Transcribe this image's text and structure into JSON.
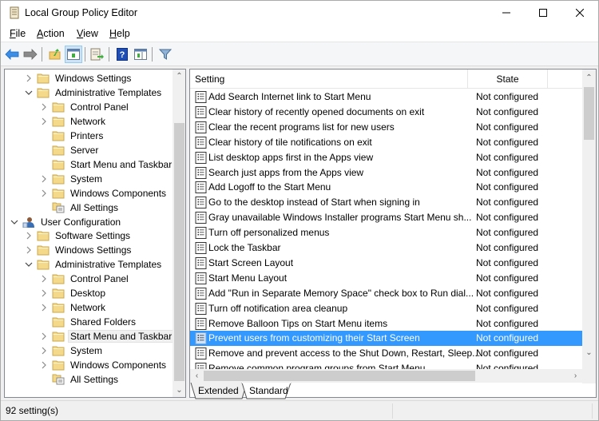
{
  "window": {
    "title": "Local Group Policy Editor",
    "app_icon": "scroll-policy-icon",
    "controls": {
      "minimize": "minimize-icon",
      "maximize": "maximize-icon",
      "close": "close-icon"
    }
  },
  "menubar": {
    "items": [
      {
        "label": "File",
        "accel": "F",
        "rest": "ile"
      },
      {
        "label": "Action",
        "accel": "A",
        "rest": "ction"
      },
      {
        "label": "View",
        "accel": "V",
        "rest": "iew"
      },
      {
        "label": "Help",
        "accel": "H",
        "rest": "elp"
      }
    ]
  },
  "toolbar": {
    "buttons": [
      {
        "name": "back",
        "icon": "arrow-left-icon"
      },
      {
        "name": "forward",
        "icon": "arrow-right-icon"
      },
      {
        "name": "up-one-level",
        "icon": "folder-up-icon"
      },
      {
        "name": "show-hide-console-tree",
        "icon": "console-tree-icon",
        "active": true
      },
      {
        "name": "export-list",
        "icon": "export-list-icon"
      },
      {
        "name": "help",
        "icon": "help-icon"
      },
      {
        "name": "show-hide-action-pane",
        "icon": "action-pane-icon"
      },
      {
        "name": "filter",
        "icon": "filter-icon"
      }
    ]
  },
  "tree": {
    "items": [
      {
        "label": "Windows Settings",
        "level": 2,
        "expander": "collapsed",
        "icon": "folder"
      },
      {
        "label": "Administrative Templates",
        "level": 2,
        "expander": "expanded",
        "icon": "folder"
      },
      {
        "label": "Control Panel",
        "level": 3,
        "expander": "collapsed",
        "icon": "folder"
      },
      {
        "label": "Network",
        "level": 3,
        "expander": "collapsed",
        "icon": "folder"
      },
      {
        "label": "Printers",
        "level": 3,
        "expander": "none",
        "icon": "folder"
      },
      {
        "label": "Server",
        "level": 3,
        "expander": "none",
        "icon": "folder"
      },
      {
        "label": "Start Menu and Taskbar",
        "level": 3,
        "expander": "none",
        "icon": "folder"
      },
      {
        "label": "System",
        "level": 3,
        "expander": "collapsed",
        "icon": "folder"
      },
      {
        "label": "Windows Components",
        "level": 3,
        "expander": "collapsed",
        "icon": "folder"
      },
      {
        "label": "All Settings",
        "level": 3,
        "expander": "none",
        "icon": "all-settings"
      },
      {
        "label": "User Configuration",
        "level": 1,
        "expander": "expanded",
        "icon": "user-config"
      },
      {
        "label": "Software Settings",
        "level": 2,
        "expander": "collapsed",
        "icon": "folder"
      },
      {
        "label": "Windows Settings",
        "level": 2,
        "expander": "collapsed",
        "icon": "folder"
      },
      {
        "label": "Administrative Templates",
        "level": 2,
        "expander": "expanded",
        "icon": "folder"
      },
      {
        "label": "Control Panel",
        "level": 3,
        "expander": "collapsed",
        "icon": "folder"
      },
      {
        "label": "Desktop",
        "level": 3,
        "expander": "collapsed",
        "icon": "folder"
      },
      {
        "label": "Network",
        "level": 3,
        "expander": "collapsed",
        "icon": "folder"
      },
      {
        "label": "Shared Folders",
        "level": 3,
        "expander": "none",
        "icon": "folder"
      },
      {
        "label": "Start Menu and Taskbar",
        "level": 3,
        "expander": "collapsed",
        "icon": "folder",
        "selected": true
      },
      {
        "label": "System",
        "level": 3,
        "expander": "collapsed",
        "icon": "folder"
      },
      {
        "label": "Windows Components",
        "level": 3,
        "expander": "collapsed",
        "icon": "folder"
      },
      {
        "label": "All Settings",
        "level": 3,
        "expander": "none",
        "icon": "all-settings"
      }
    ]
  },
  "list": {
    "columns": {
      "setting": "Setting",
      "state": "State"
    },
    "rows": [
      {
        "setting": "Add Search Internet link to Start Menu",
        "state": "Not configured"
      },
      {
        "setting": "Clear history of recently opened documents on exit",
        "state": "Not configured"
      },
      {
        "setting": "Clear the recent programs list for new users",
        "state": "Not configured"
      },
      {
        "setting": "Clear history of tile notifications on exit",
        "state": "Not configured"
      },
      {
        "setting": "List desktop apps first in the Apps view",
        "state": "Not configured"
      },
      {
        "setting": "Search just apps from the Apps view",
        "state": "Not configured"
      },
      {
        "setting": "Add Logoff to the Start Menu",
        "state": "Not configured"
      },
      {
        "setting": "Go to the desktop instead of Start when signing in",
        "state": "Not configured"
      },
      {
        "setting": "Gray unavailable Windows Installer programs Start Menu sh...",
        "state": "Not configured"
      },
      {
        "setting": "Turn off personalized menus",
        "state": "Not configured"
      },
      {
        "setting": "Lock the Taskbar",
        "state": "Not configured"
      },
      {
        "setting": "Start Screen Layout",
        "state": "Not configured"
      },
      {
        "setting": "Start Menu Layout",
        "state": "Not configured"
      },
      {
        "setting": "Add \"Run in Separate Memory Space\" check box to Run dial...",
        "state": "Not configured"
      },
      {
        "setting": "Turn off notification area cleanup",
        "state": "Not configured"
      },
      {
        "setting": "Remove Balloon Tips on Start Menu items",
        "state": "Not configured"
      },
      {
        "setting": "Prevent users from customizing their Start Screen",
        "state": "Not configured",
        "selected": true
      },
      {
        "setting": "Remove and prevent access to the Shut Down, Restart, Sleep...",
        "state": "Not configured"
      },
      {
        "setting": "Remove common program groups from Start Menu",
        "state": "Not configured"
      }
    ]
  },
  "tabs": [
    {
      "label": "Extended",
      "active": false
    },
    {
      "label": "Standard",
      "active": true
    }
  ],
  "statusbar": {
    "text": "92 setting(s)"
  },
  "colors": {
    "selection": "#3399ff",
    "folder": "#f5d98b",
    "accent_blue": "#2b7bd6"
  }
}
